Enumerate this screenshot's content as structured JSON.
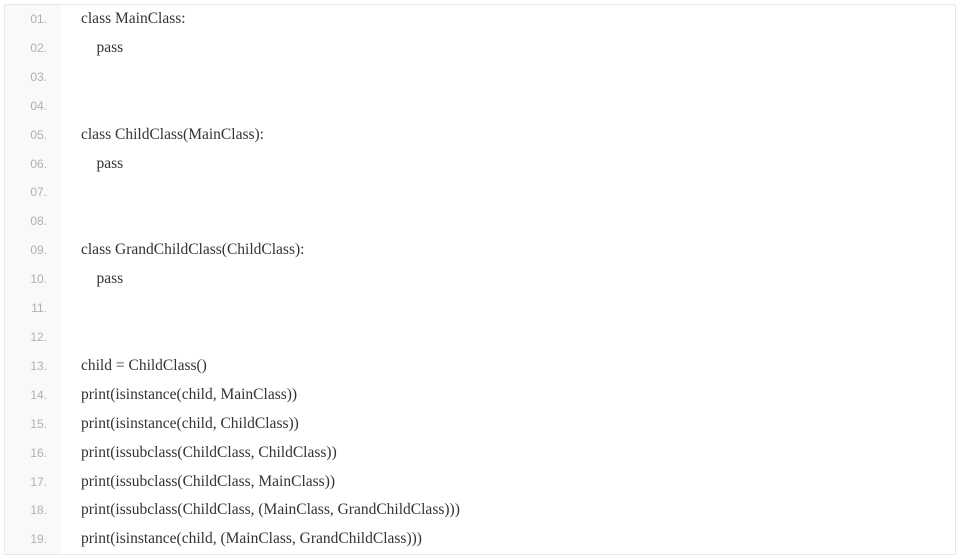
{
  "code": {
    "lines": [
      {
        "num": "01.",
        "text": "class MainClass:"
      },
      {
        "num": "02.",
        "text": "    pass"
      },
      {
        "num": "03.",
        "text": ""
      },
      {
        "num": "04.",
        "text": ""
      },
      {
        "num": "05.",
        "text": "class ChildClass(MainClass):"
      },
      {
        "num": "06.",
        "text": "    pass"
      },
      {
        "num": "07.",
        "text": ""
      },
      {
        "num": "08.",
        "text": ""
      },
      {
        "num": "09.",
        "text": "class GrandChildClass(ChildClass):"
      },
      {
        "num": "10.",
        "text": "    pass"
      },
      {
        "num": "11.",
        "text": ""
      },
      {
        "num": "12.",
        "text": ""
      },
      {
        "num": "13.",
        "text": "child = ChildClass()"
      },
      {
        "num": "14.",
        "text": "print(isinstance(child, MainClass))"
      },
      {
        "num": "15.",
        "text": "print(isinstance(child, ChildClass))"
      },
      {
        "num": "16.",
        "text": "print(issubclass(ChildClass, ChildClass))"
      },
      {
        "num": "17.",
        "text": "print(issubclass(ChildClass, MainClass))"
      },
      {
        "num": "18.",
        "text": "print(issubclass(ChildClass, (MainClass, GrandChildClass)))"
      },
      {
        "num": "19.",
        "text": "print(isinstance(child, (MainClass, GrandChildClass)))"
      }
    ]
  }
}
